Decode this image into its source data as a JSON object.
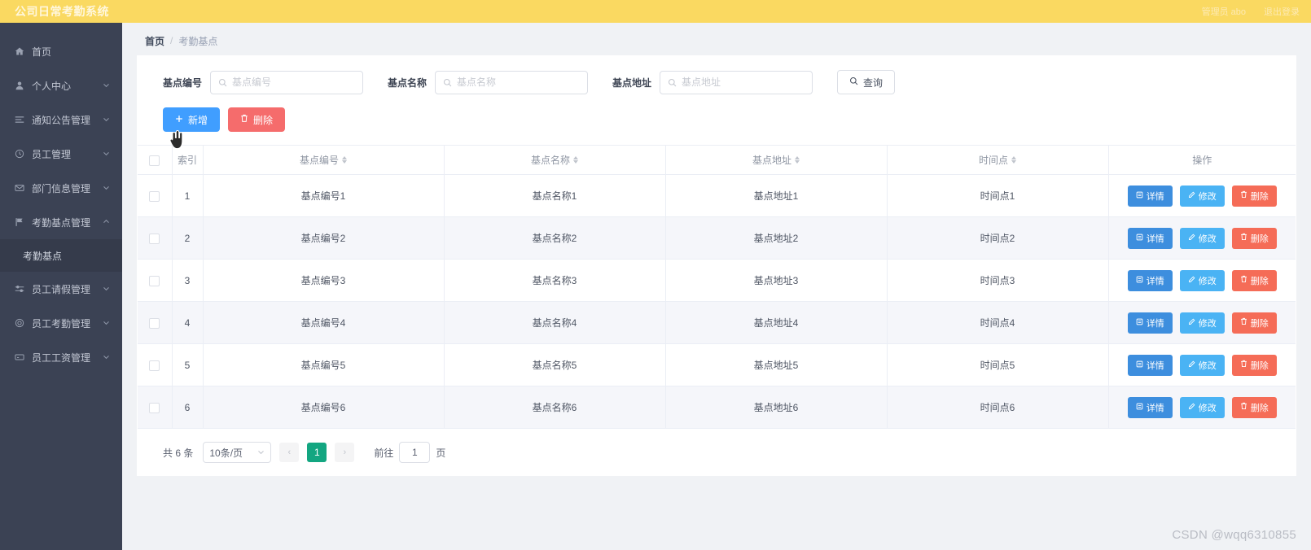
{
  "header": {
    "brand": "公司日常考勤系统",
    "user": "管理员 abo",
    "logout": "退出登录"
  },
  "sidebar": {
    "items": [
      {
        "label": "首页",
        "icon": "home-icon",
        "expandable": false
      },
      {
        "label": "个人中心",
        "icon": "user-icon",
        "expandable": true
      },
      {
        "label": "通知公告管理",
        "icon": "list-icon",
        "expandable": true
      },
      {
        "label": "员工管理",
        "icon": "clock-icon",
        "expandable": true
      },
      {
        "label": "部门信息管理",
        "icon": "envelope-icon",
        "expandable": true
      },
      {
        "label": "考勤基点管理",
        "icon": "flag-icon",
        "expandable": true,
        "open": true
      },
      {
        "label": "员工请假管理",
        "icon": "sliders-icon",
        "expandable": true
      },
      {
        "label": "员工考勤管理",
        "icon": "target-icon",
        "expandable": true
      },
      {
        "label": "员工工资管理",
        "icon": "card-icon",
        "expandable": true
      }
    ],
    "sub_item": "考勤基点"
  },
  "breadcrumb": {
    "home": "首页",
    "separator": "/",
    "current": "考勤基点"
  },
  "search": {
    "fields": [
      {
        "label": "基点编号",
        "placeholder": "基点编号",
        "value": ""
      },
      {
        "label": "基点名称",
        "placeholder": "基点名称",
        "value": ""
      },
      {
        "label": "基点地址",
        "placeholder": "基点地址",
        "value": ""
      }
    ],
    "query_button": "查询"
  },
  "toolbar": {
    "add_label": "新增",
    "delete_label": "删除"
  },
  "table": {
    "columns": [
      {
        "label": "索引",
        "sortable": false
      },
      {
        "label": "基点编号",
        "sortable": true
      },
      {
        "label": "基点名称",
        "sortable": true
      },
      {
        "label": "基点地址",
        "sortable": true
      },
      {
        "label": "时间点",
        "sortable": true
      },
      {
        "label": "操作",
        "sortable": false
      }
    ],
    "row_actions": {
      "detail": "详情",
      "edit": "修改",
      "delete": "删除"
    },
    "rows": [
      {
        "index": "1",
        "code": "基点编号1",
        "name": "基点名称1",
        "address": "基点地址1",
        "time": "时间点1"
      },
      {
        "index": "2",
        "code": "基点编号2",
        "name": "基点名称2",
        "address": "基点地址2",
        "time": "时间点2"
      },
      {
        "index": "3",
        "code": "基点编号3",
        "name": "基点名称3",
        "address": "基点地址3",
        "time": "时间点3"
      },
      {
        "index": "4",
        "code": "基点编号4",
        "name": "基点名称4",
        "address": "基点地址4",
        "time": "时间点4"
      },
      {
        "index": "5",
        "code": "基点编号5",
        "name": "基点名称5",
        "address": "基点地址5",
        "time": "时间点5"
      },
      {
        "index": "6",
        "code": "基点编号6",
        "name": "基点名称6",
        "address": "基点地址6",
        "time": "时间点6"
      }
    ]
  },
  "pagination": {
    "total_text": "共 6 条",
    "page_size": "10条/页",
    "prev": "‹",
    "next": "›",
    "current_page": "1",
    "goto_label": "前往",
    "goto_value": "1",
    "page_unit": "页"
  },
  "watermark": "CSDN @wqq6310855",
  "colors": {
    "header_bg": "#fad961",
    "sidebar_bg": "#3b4254",
    "primary": "#409eff",
    "danger": "#f56c6c",
    "edit": "#4ab3f4",
    "pager_active": "#13a681"
  }
}
